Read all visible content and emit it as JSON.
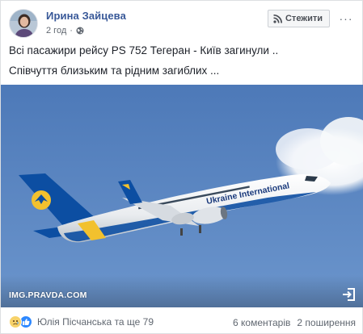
{
  "header": {
    "author": "Ирина Зайцева",
    "time": "2 год",
    "privacy_icon": "globe-icon",
    "follow_label": "Стежити",
    "follow_icon": "rss-icon",
    "more_label": "···"
  },
  "post": {
    "line1": "Всі пасажири рейсу PS 752 Тегеран - Київ загинули ..",
    "line2": "Співчуття близьким та рідним загиблих ..."
  },
  "photo": {
    "source": "IMG.PRAVDA.COM",
    "plane_livery": "Ukraine International",
    "open_icon": "open-link-icon",
    "colors": {
      "sky": "#5480bf",
      "fuselage": "#f2f2f2",
      "tail_blue": "#0c4ea2",
      "tail_yellow": "#f2c12e"
    }
  },
  "footer": {
    "reactions": [
      "sad",
      "like"
    ],
    "reactors": "Юлія Пісчанська та ще 79",
    "comments": "6 коментарів",
    "shares": "2 поширення"
  }
}
